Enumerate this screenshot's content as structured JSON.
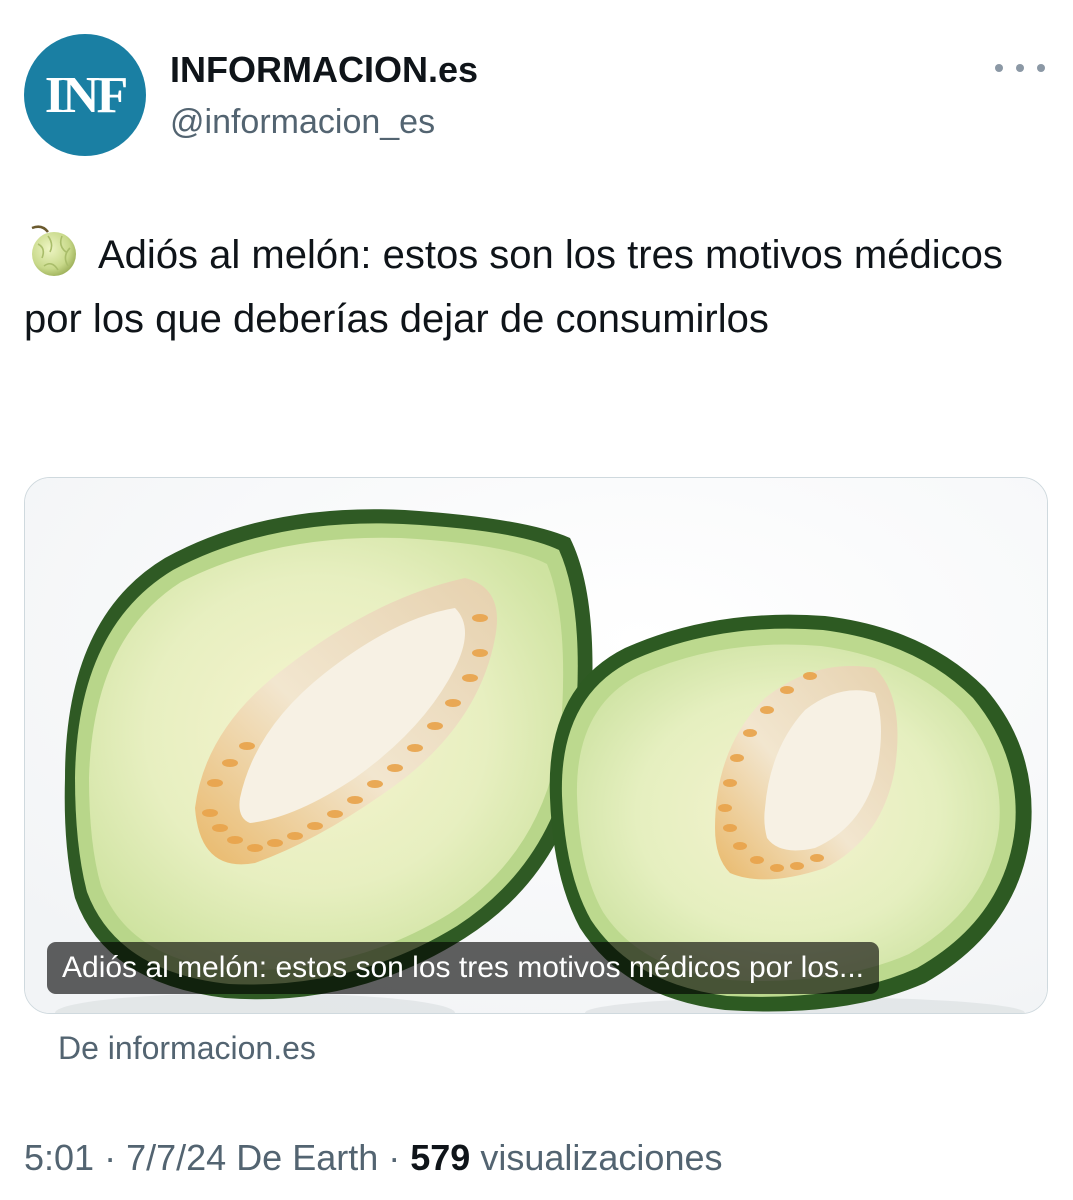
{
  "author": {
    "avatar_text": "INF",
    "display_name": "INFORMACION.es",
    "handle": "@informacion_es"
  },
  "tweet": {
    "emoji_icon": "melon-icon",
    "text": "Adiós al melón: estos son los tres motivos médicos por los que deberías dejar de consumirlos"
  },
  "card": {
    "image_description_icon": "melon-halves-image",
    "caption": "Adiós al melón: estos son los tres motivos médicos por los...",
    "source": "De informacion.es"
  },
  "meta": {
    "time": "5:01",
    "separator": " · ",
    "date": "7/7/24",
    "origin": "De Earth",
    "views_count": "579",
    "views_label": "visualizaciones"
  },
  "colors": {
    "avatar_bg": "#1a7fa3",
    "secondary_text": "#536471",
    "primary_text": "#0f1419"
  }
}
